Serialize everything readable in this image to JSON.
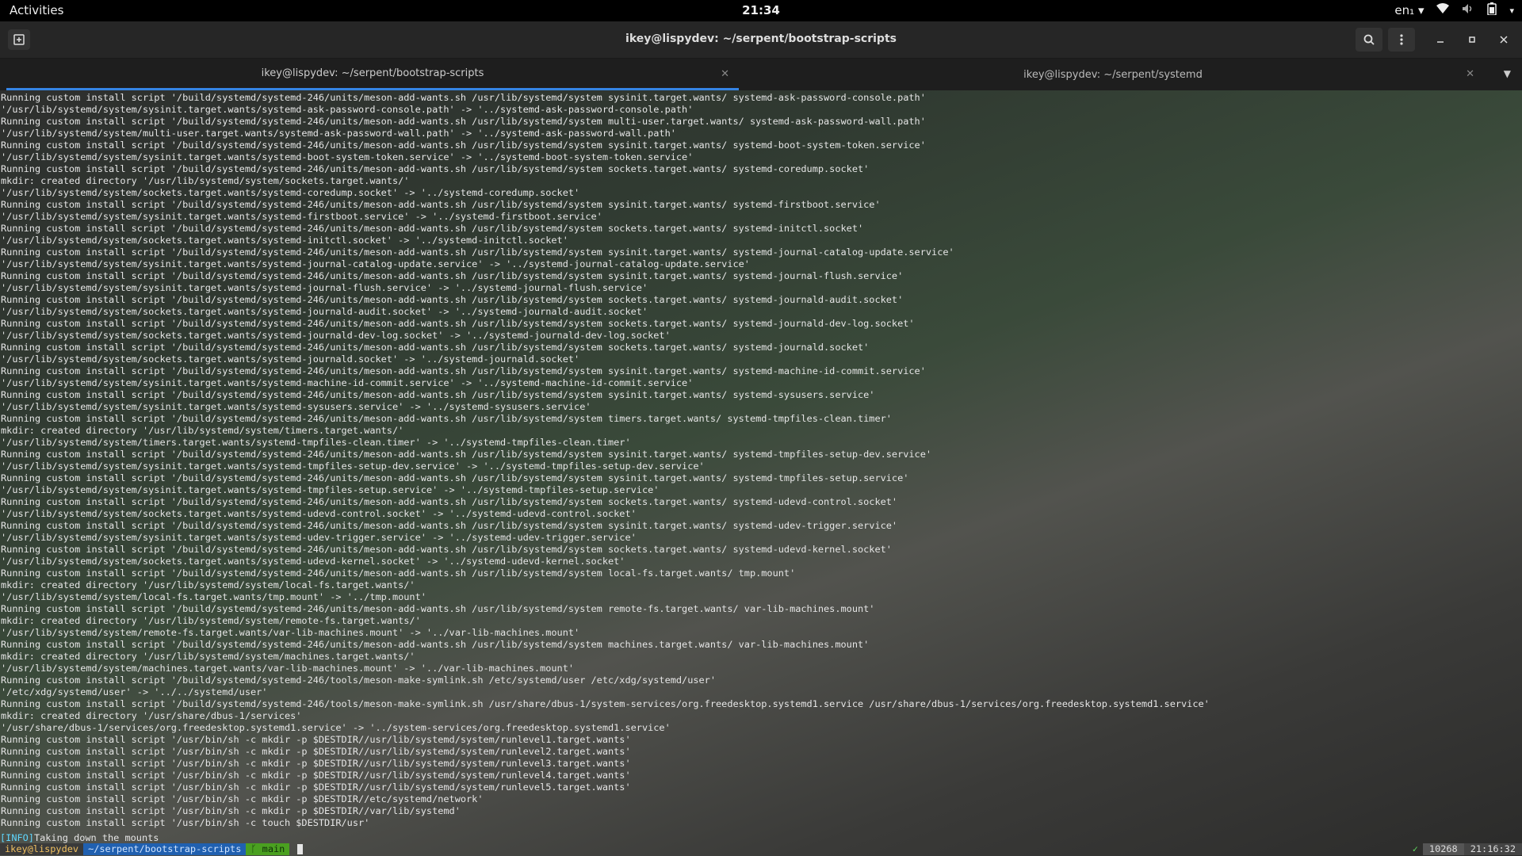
{
  "topbar": {
    "activities": "Activities",
    "clock": "21:34",
    "lang": "en₁ ▾"
  },
  "window": {
    "title": "ikey@lispydev: ~/serpent/bootstrap-scripts",
    "tabs": [
      {
        "label": "ikey@lispydev: ~/serpent/bootstrap-scripts",
        "active": true
      },
      {
        "label": "ikey@lispydev: ~/serpent/systemd",
        "active": false
      }
    ]
  },
  "terminal": {
    "lines": [
      "Running custom install script '/build/systemd/systemd-246/units/meson-add-wants.sh /usr/lib/systemd/system sysinit.target.wants/ systemd-ask-password-console.path'",
      "'/usr/lib/systemd/system/sysinit.target.wants/systemd-ask-password-console.path' -> '../systemd-ask-password-console.path'",
      "Running custom install script '/build/systemd/systemd-246/units/meson-add-wants.sh /usr/lib/systemd/system multi-user.target.wants/ systemd-ask-password-wall.path'",
      "'/usr/lib/systemd/system/multi-user.target.wants/systemd-ask-password-wall.path' -> '../systemd-ask-password-wall.path'",
      "Running custom install script '/build/systemd/systemd-246/units/meson-add-wants.sh /usr/lib/systemd/system sysinit.target.wants/ systemd-boot-system-token.service'",
      "'/usr/lib/systemd/system/sysinit.target.wants/systemd-boot-system-token.service' -> '../systemd-boot-system-token.service'",
      "Running custom install script '/build/systemd/systemd-246/units/meson-add-wants.sh /usr/lib/systemd/system sockets.target.wants/ systemd-coredump.socket'",
      "mkdir: created directory '/usr/lib/systemd/system/sockets.target.wants/'",
      "'/usr/lib/systemd/system/sockets.target.wants/systemd-coredump.socket' -> '../systemd-coredump.socket'",
      "Running custom install script '/build/systemd/systemd-246/units/meson-add-wants.sh /usr/lib/systemd/system sysinit.target.wants/ systemd-firstboot.service'",
      "'/usr/lib/systemd/system/sysinit.target.wants/systemd-firstboot.service' -> '../systemd-firstboot.service'",
      "Running custom install script '/build/systemd/systemd-246/units/meson-add-wants.sh /usr/lib/systemd/system sockets.target.wants/ systemd-initctl.socket'",
      "'/usr/lib/systemd/system/sockets.target.wants/systemd-initctl.socket' -> '../systemd-initctl.socket'",
      "Running custom install script '/build/systemd/systemd-246/units/meson-add-wants.sh /usr/lib/systemd/system sysinit.target.wants/ systemd-journal-catalog-update.service'",
      "'/usr/lib/systemd/system/sysinit.target.wants/systemd-journal-catalog-update.service' -> '../systemd-journal-catalog-update.service'",
      "Running custom install script '/build/systemd/systemd-246/units/meson-add-wants.sh /usr/lib/systemd/system sysinit.target.wants/ systemd-journal-flush.service'",
      "'/usr/lib/systemd/system/sysinit.target.wants/systemd-journal-flush.service' -> '../systemd-journal-flush.service'",
      "Running custom install script '/build/systemd/systemd-246/units/meson-add-wants.sh /usr/lib/systemd/system sockets.target.wants/ systemd-journald-audit.socket'",
      "'/usr/lib/systemd/system/sockets.target.wants/systemd-journald-audit.socket' -> '../systemd-journald-audit.socket'",
      "Running custom install script '/build/systemd/systemd-246/units/meson-add-wants.sh /usr/lib/systemd/system sockets.target.wants/ systemd-journald-dev-log.socket'",
      "'/usr/lib/systemd/system/sockets.target.wants/systemd-journald-dev-log.socket' -> '../systemd-journald-dev-log.socket'",
      "Running custom install script '/build/systemd/systemd-246/units/meson-add-wants.sh /usr/lib/systemd/system sockets.target.wants/ systemd-journald.socket'",
      "'/usr/lib/systemd/system/sockets.target.wants/systemd-journald.socket' -> '../systemd-journald.socket'",
      "Running custom install script '/build/systemd/systemd-246/units/meson-add-wants.sh /usr/lib/systemd/system sysinit.target.wants/ systemd-machine-id-commit.service'",
      "'/usr/lib/systemd/system/sysinit.target.wants/systemd-machine-id-commit.service' -> '../systemd-machine-id-commit.service'",
      "Running custom install script '/build/systemd/systemd-246/units/meson-add-wants.sh /usr/lib/systemd/system sysinit.target.wants/ systemd-sysusers.service'",
      "'/usr/lib/systemd/system/sysinit.target.wants/systemd-sysusers.service' -> '../systemd-sysusers.service'",
      "Running custom install script '/build/systemd/systemd-246/units/meson-add-wants.sh /usr/lib/systemd/system timers.target.wants/ systemd-tmpfiles-clean.timer'",
      "mkdir: created directory '/usr/lib/systemd/system/timers.target.wants/'",
      "'/usr/lib/systemd/system/timers.target.wants/systemd-tmpfiles-clean.timer' -> '../systemd-tmpfiles-clean.timer'",
      "Running custom install script '/build/systemd/systemd-246/units/meson-add-wants.sh /usr/lib/systemd/system sysinit.target.wants/ systemd-tmpfiles-setup-dev.service'",
      "'/usr/lib/systemd/system/sysinit.target.wants/systemd-tmpfiles-setup-dev.service' -> '../systemd-tmpfiles-setup-dev.service'",
      "Running custom install script '/build/systemd/systemd-246/units/meson-add-wants.sh /usr/lib/systemd/system sysinit.target.wants/ systemd-tmpfiles-setup.service'",
      "'/usr/lib/systemd/system/sysinit.target.wants/systemd-tmpfiles-setup.service' -> '../systemd-tmpfiles-setup.service'",
      "Running custom install script '/build/systemd/systemd-246/units/meson-add-wants.sh /usr/lib/systemd/system sockets.target.wants/ systemd-udevd-control.socket'",
      "'/usr/lib/systemd/system/sockets.target.wants/systemd-udevd-control.socket' -> '../systemd-udevd-control.socket'",
      "Running custom install script '/build/systemd/systemd-246/units/meson-add-wants.sh /usr/lib/systemd/system sysinit.target.wants/ systemd-udev-trigger.service'",
      "'/usr/lib/systemd/system/sysinit.target.wants/systemd-udev-trigger.service' -> '../systemd-udev-trigger.service'",
      "Running custom install script '/build/systemd/systemd-246/units/meson-add-wants.sh /usr/lib/systemd/system sockets.target.wants/ systemd-udevd-kernel.socket'",
      "'/usr/lib/systemd/system/sockets.target.wants/systemd-udevd-kernel.socket' -> '../systemd-udevd-kernel.socket'",
      "Running custom install script '/build/systemd/systemd-246/units/meson-add-wants.sh /usr/lib/systemd/system local-fs.target.wants/ tmp.mount'",
      "mkdir: created directory '/usr/lib/systemd/system/local-fs.target.wants/'",
      "'/usr/lib/systemd/system/local-fs.target.wants/tmp.mount' -> '../tmp.mount'",
      "Running custom install script '/build/systemd/systemd-246/units/meson-add-wants.sh /usr/lib/systemd/system remote-fs.target.wants/ var-lib-machines.mount'",
      "mkdir: created directory '/usr/lib/systemd/system/remote-fs.target.wants/'",
      "'/usr/lib/systemd/system/remote-fs.target.wants/var-lib-machines.mount' -> '../var-lib-machines.mount'",
      "Running custom install script '/build/systemd/systemd-246/units/meson-add-wants.sh /usr/lib/systemd/system machines.target.wants/ var-lib-machines.mount'",
      "mkdir: created directory '/usr/lib/systemd/system/machines.target.wants/'",
      "'/usr/lib/systemd/system/machines.target.wants/var-lib-machines.mount' -> '../var-lib-machines.mount'",
      "Running custom install script '/build/systemd/systemd-246/tools/meson-make-symlink.sh /etc/systemd/user /etc/xdg/systemd/user'",
      "'/etc/xdg/systemd/user' -> '../../systemd/user'",
      "Running custom install script '/build/systemd/systemd-246/tools/meson-make-symlink.sh /usr/share/dbus-1/system-services/org.freedesktop.systemd1.service /usr/share/dbus-1/services/org.freedesktop.systemd1.service'",
      "mkdir: created directory '/usr/share/dbus-1/services'",
      "'/usr/share/dbus-1/services/org.freedesktop.systemd1.service' -> '../system-services/org.freedesktop.systemd1.service'",
      "Running custom install script '/usr/bin/sh -c mkdir -p $DESTDIR//usr/lib/systemd/system/runlevel1.target.wants'",
      "Running custom install script '/usr/bin/sh -c mkdir -p $DESTDIR//usr/lib/systemd/system/runlevel2.target.wants'",
      "Running custom install script '/usr/bin/sh -c mkdir -p $DESTDIR//usr/lib/systemd/system/runlevel3.target.wants'",
      "Running custom install script '/usr/bin/sh -c mkdir -p $DESTDIR//usr/lib/systemd/system/runlevel4.target.wants'",
      "Running custom install script '/usr/bin/sh -c mkdir -p $DESTDIR//usr/lib/systemd/system/runlevel5.target.wants'",
      "Running custom install script '/usr/bin/sh -c mkdir -p $DESTDIR//etc/systemd/network'",
      "Running custom install script '/usr/bin/sh -c mkdir -p $DESTDIR//var/lib/systemd'",
      "Running custom install script '/usr/bin/sh -c touch $DESTDIR/usr'"
    ],
    "info_tag": "[INFO]",
    "info_text": " Taking down the mounts",
    "prompt": {
      "user": "ikey@lispydev",
      "path": "~/serpent/bootstrap-scripts",
      "branch": "ᚴ main"
    },
    "rprompt": {
      "status": "✓",
      "id": "10268",
      "time": "21:16:32"
    }
  }
}
